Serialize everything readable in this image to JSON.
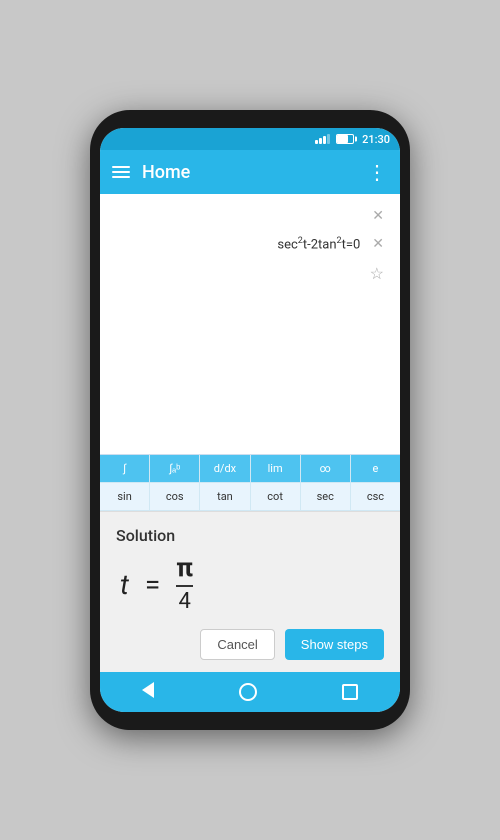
{
  "status_bar": {
    "time": "21:30"
  },
  "app_bar": {
    "title": "Home",
    "more_label": "⋮"
  },
  "equations": [
    {
      "text": "",
      "has_close": true,
      "has_star": false
    },
    {
      "text": "sec²t-2tan²t=0",
      "has_close": true,
      "has_star": false
    },
    {
      "text": "",
      "has_close": false,
      "has_star": true
    }
  ],
  "keyboard": {
    "row1": [
      "∫",
      "∫ₐᵇ",
      "d/dx",
      "lim",
      "∞",
      "e"
    ],
    "row2": [
      "sin",
      "cos",
      "tan",
      "cot",
      "sec",
      "csc"
    ]
  },
  "solution": {
    "label": "Solution",
    "variable": "t",
    "equals": "=",
    "numerator": "π",
    "denominator": "4"
  },
  "buttons": {
    "cancel": "Cancel",
    "show_steps": "Show steps"
  },
  "nav": {
    "back": "",
    "home": "",
    "recent": ""
  }
}
